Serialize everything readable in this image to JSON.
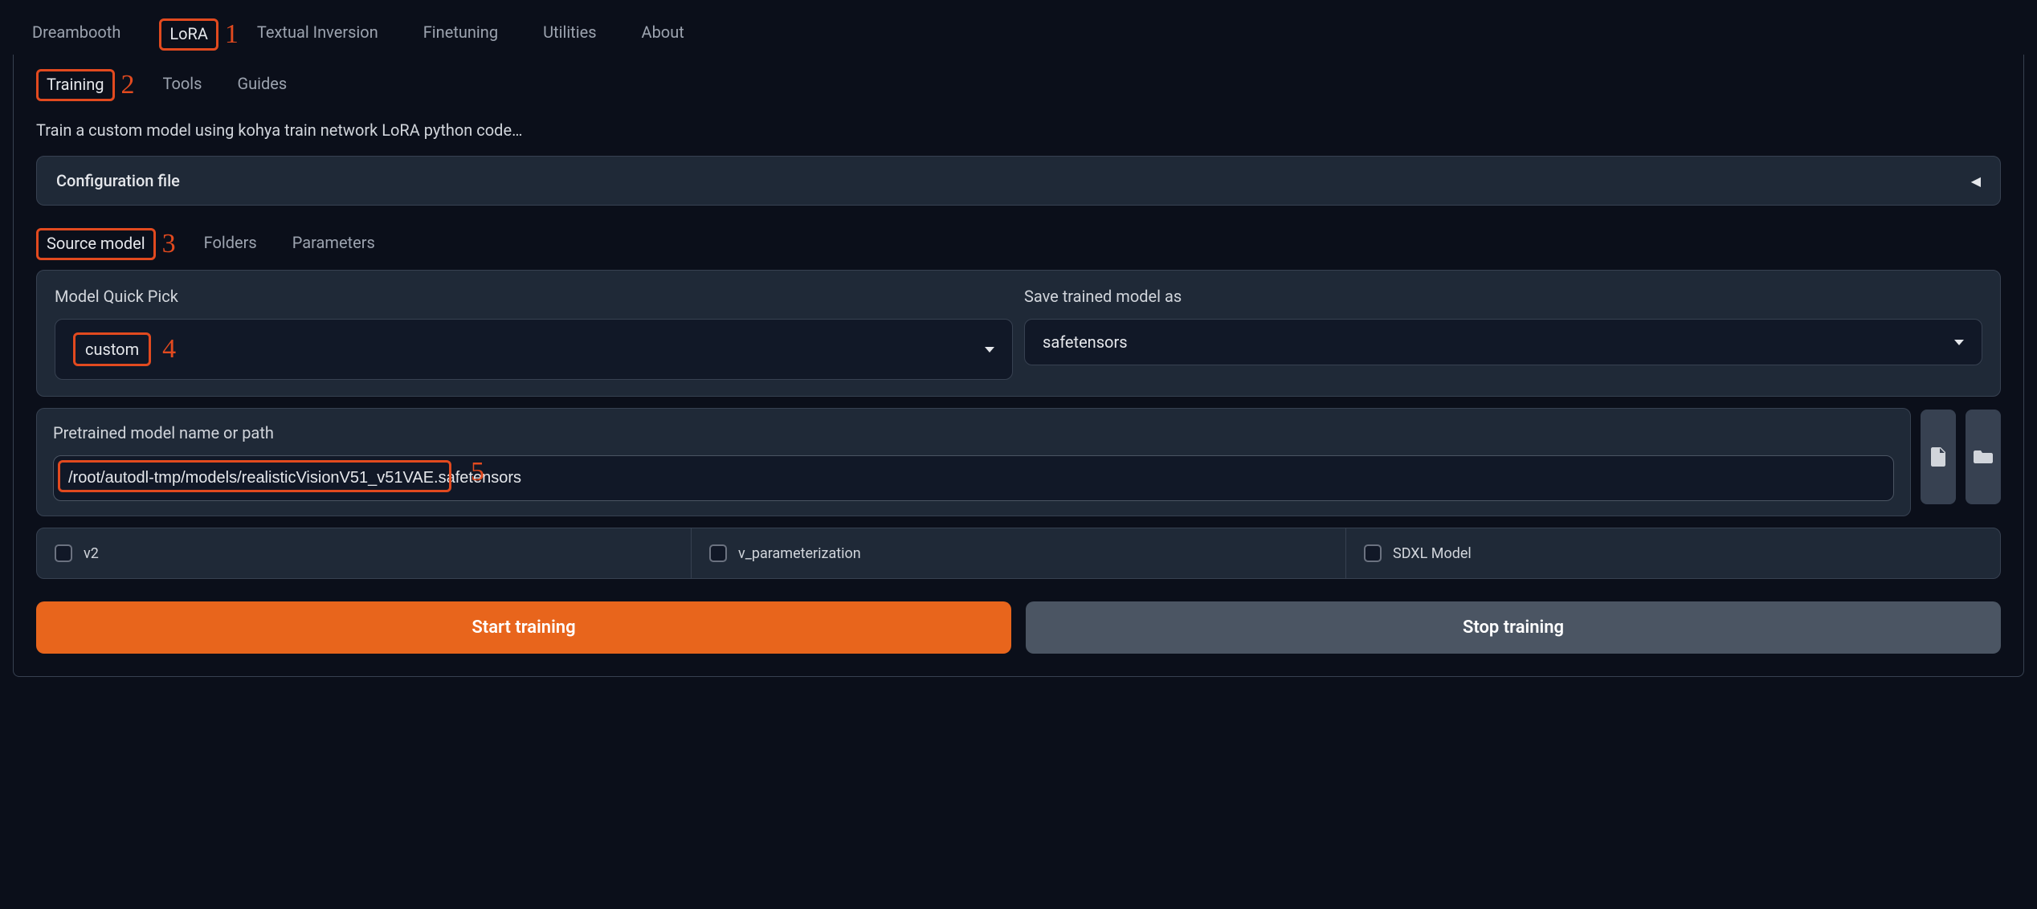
{
  "mainTabs": {
    "dreambooth": "Dreambooth",
    "lora": "LoRA",
    "textualInversion": "Textual Inversion",
    "finetuning": "Finetuning",
    "utilities": "Utilities",
    "about": "About"
  },
  "subTabs": {
    "training": "Training",
    "tools": "Tools",
    "guides": "Guides"
  },
  "description": "Train a custom model using kohya train network LoRA python code…",
  "config": {
    "label": "Configuration file"
  },
  "sub2Tabs": {
    "sourceModel": "Source model",
    "folders": "Folders",
    "parameters": "Parameters"
  },
  "modelQuickPick": {
    "label": "Model Quick Pick",
    "value": "custom"
  },
  "saveAs": {
    "label": "Save trained model as",
    "value": "safetensors"
  },
  "pretrained": {
    "label": "Pretrained model name or path",
    "value": "/root/autodl-tmp/models/realisticVisionV51_v51VAE.safetensors"
  },
  "checks": {
    "v2": "v2",
    "vparam": "v_parameterization",
    "sdxl": "SDXL Model"
  },
  "buttons": {
    "start": "Start training",
    "stop": "Stop training"
  },
  "annotations": {
    "a1": "1",
    "a2": "2",
    "a3": "3",
    "a4": "4",
    "a5": "5"
  }
}
